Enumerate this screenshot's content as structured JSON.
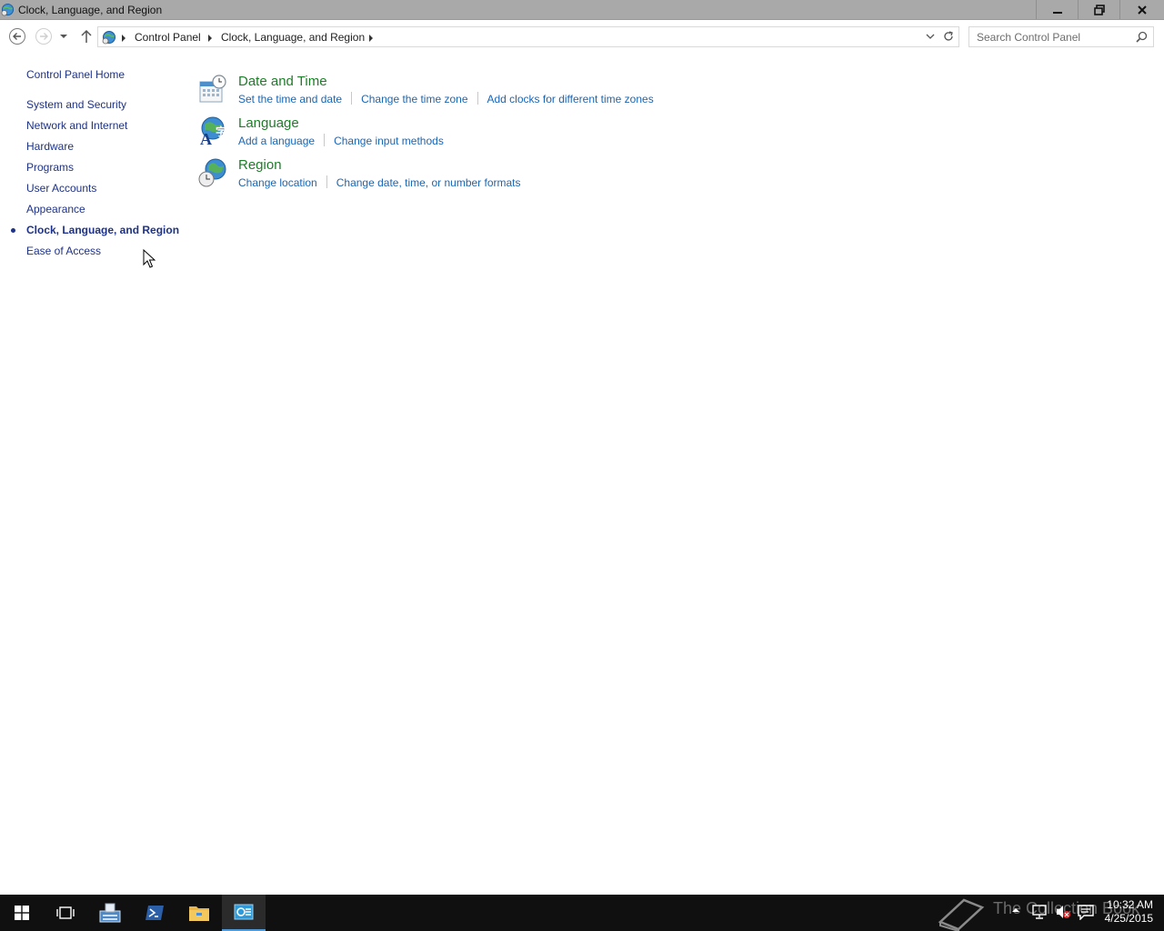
{
  "window": {
    "title": "Clock, Language, and Region",
    "controls": [
      "minimize",
      "restore",
      "close"
    ]
  },
  "address_bar": {
    "breadcrumbs": [
      "Control Panel",
      "Clock, Language, and Region"
    ],
    "search_placeholder": "Search Control Panel"
  },
  "sidebar": {
    "home": "Control Panel Home",
    "items": [
      {
        "label": "System and Security",
        "current": false
      },
      {
        "label": "Network and Internet",
        "current": false
      },
      {
        "label": "Hardware",
        "current": false
      },
      {
        "label": "Programs",
        "current": false
      },
      {
        "label": "User Accounts",
        "current": false
      },
      {
        "label": "Appearance",
        "current": false
      },
      {
        "label": "Clock, Language, and Region",
        "current": true
      },
      {
        "label": "Ease of Access",
        "current": false
      }
    ]
  },
  "categories": [
    {
      "title": "Date and Time",
      "icon": "calendar-clock-icon",
      "links": [
        "Set the time and date",
        "Change the time zone",
        "Add clocks for different time zones"
      ]
    },
    {
      "title": "Language",
      "icon": "language-globe-icon",
      "links": [
        "Add a language",
        "Change input methods"
      ]
    },
    {
      "title": "Region",
      "icon": "region-globe-icon",
      "links": [
        "Change location",
        "Change date, time, or number formats"
      ]
    }
  ],
  "taskbar": {
    "watermark": "The Collection Book",
    "time": "10:32 AM",
    "date": "4/25/2015"
  },
  "colors": {
    "title_bar": "#a9a9a9",
    "category_heading": "#1d7d28",
    "task_link": "#1a66b5",
    "nav_link": "#1e3287",
    "taskbar": "#101010"
  }
}
